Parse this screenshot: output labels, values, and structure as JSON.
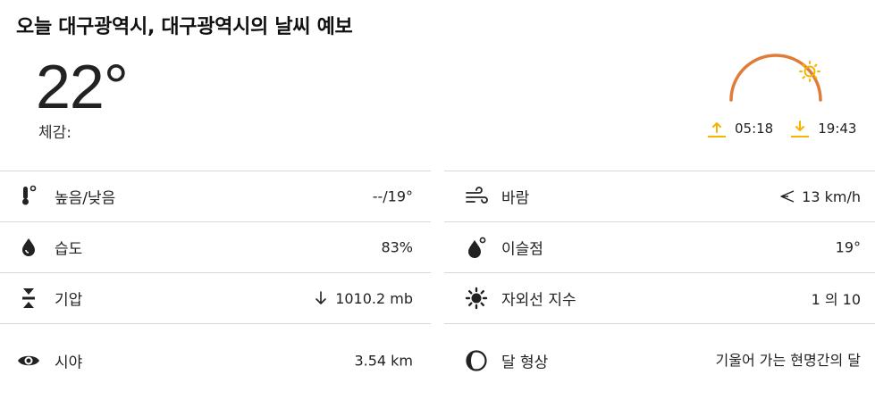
{
  "header": {
    "title": "오늘 대구광역시, 대구광역시의 날씨 예보"
  },
  "current": {
    "temperature": "22°",
    "feels_like_label": "체감:"
  },
  "sun": {
    "sunrise": "05:18",
    "sunset": "19:43",
    "accent_color": "#e07b39",
    "arrow_color": "#f5b400"
  },
  "details": {
    "left": [
      {
        "label": "높음/낮음",
        "value": "--/19°",
        "icon": "thermometer-icon"
      },
      {
        "label": "습도",
        "value": "83%",
        "icon": "humidity-drop-icon"
      },
      {
        "label": "기압",
        "value": "1010.2 mb",
        "icon": "pressure-icon",
        "value_icon": "arrow-down-icon"
      },
      {
        "label": "시야",
        "value": "3.54 km",
        "icon": "eye-icon"
      }
    ],
    "right": [
      {
        "label": "바람",
        "value": "13 km/h",
        "icon": "wind-icon",
        "value_icon": "wind-direction-icon"
      },
      {
        "label": "이슬점",
        "value": "19°",
        "icon": "dew-point-icon"
      },
      {
        "label": "자외선 지수",
        "value": "1 의 10",
        "icon": "uv-sun-icon"
      },
      {
        "label": "달 형상",
        "value": "기울어 가는 현명간의 달",
        "icon": "moon-phase-icon"
      }
    ]
  }
}
